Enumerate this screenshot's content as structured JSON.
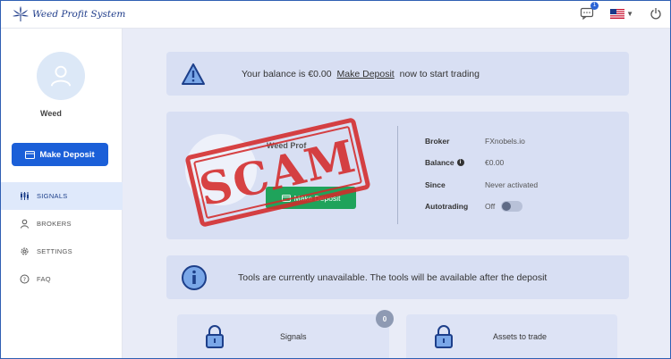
{
  "app": {
    "logo_text": "Weed Profit System"
  },
  "header": {
    "chat_badge_count": "1",
    "language_flag": "us-flag-icon"
  },
  "sidebar": {
    "username": "Weed",
    "deposit_button": "Make Deposit",
    "nav": [
      {
        "label": "SIGNALS",
        "icon": "signals-icon",
        "active": true
      },
      {
        "label": "BROKERS",
        "icon": "user-icon",
        "active": false
      },
      {
        "label": "SETTINGS",
        "icon": "gear-icon",
        "active": false
      },
      {
        "label": "FAQ",
        "icon": "question-icon",
        "active": false
      }
    ]
  },
  "balance_alert": {
    "prefix": "Your balance is €0.00",
    "link": "Make Deposit",
    "suffix": "now to start trading"
  },
  "broker_card": {
    "name": "Weed Prof",
    "deposit_button": "Make Deposit",
    "rows": {
      "broker": {
        "key": "Broker",
        "value": "FXnobels.io"
      },
      "balance": {
        "key": "Balance",
        "value": "€0.00"
      },
      "since": {
        "key": "Since",
        "value": "Never activated"
      },
      "autotrading": {
        "key": "Autotrading",
        "value": "Off"
      }
    }
  },
  "stamp": {
    "text": "SCAM",
    "color": "#d42a2a"
  },
  "tools_alert": {
    "text": "Tools are currently unavailable. The tools will be available after the deposit"
  },
  "tools": {
    "signals": {
      "label": "Signals",
      "badge": "0"
    },
    "assets": {
      "label": "Assets to trade"
    }
  },
  "colors": {
    "primary": "#1b5fd8",
    "success": "#1fa35b",
    "card": "#d8dff3"
  }
}
